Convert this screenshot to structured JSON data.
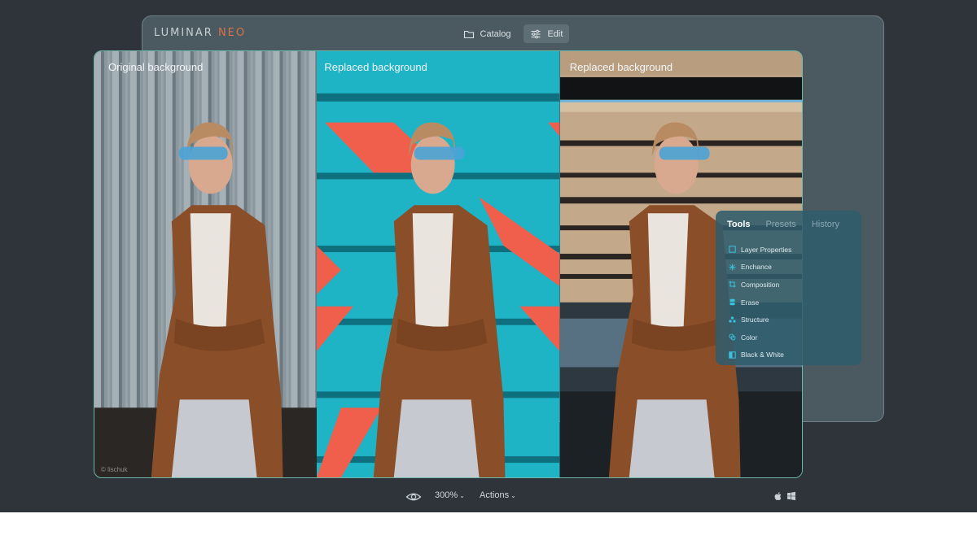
{
  "app": {
    "logo_main": "LUMINAR",
    "logo_accent": "NEO",
    "accent_color": "#d8734a"
  },
  "topnav": {
    "catalog_label": "Catalog",
    "catalog_icon": "folder-icon",
    "edit_label": "Edit",
    "edit_icon": "sliders-icon",
    "active": "Edit"
  },
  "panels": [
    {
      "label": "Original background",
      "credit": "© lischuk"
    },
    {
      "label": "Replaced background"
    },
    {
      "label": "Replaced background"
    }
  ],
  "tools_panel": {
    "tabs": [
      "Tools",
      "Presets",
      "History"
    ],
    "active_tab": "Tools",
    "items": [
      {
        "label": "Layer Properties",
        "icon": "layer-square-icon"
      },
      {
        "label": "Enchance",
        "icon": "sparkle-icon"
      },
      {
        "label": "Composition",
        "icon": "crop-icon"
      },
      {
        "label": "Erase",
        "icon": "eraser-icon"
      },
      {
        "label": "Structure",
        "icon": "structure-icon"
      },
      {
        "label": "Color",
        "icon": "color-icon"
      },
      {
        "label": "Black & White",
        "icon": "black-white-icon"
      }
    ]
  },
  "bottombar": {
    "zoom": "300%",
    "actions_label": "Actions",
    "eye_icon": "eye-icon",
    "platforms": [
      "apple-icon",
      "windows-icon"
    ]
  }
}
